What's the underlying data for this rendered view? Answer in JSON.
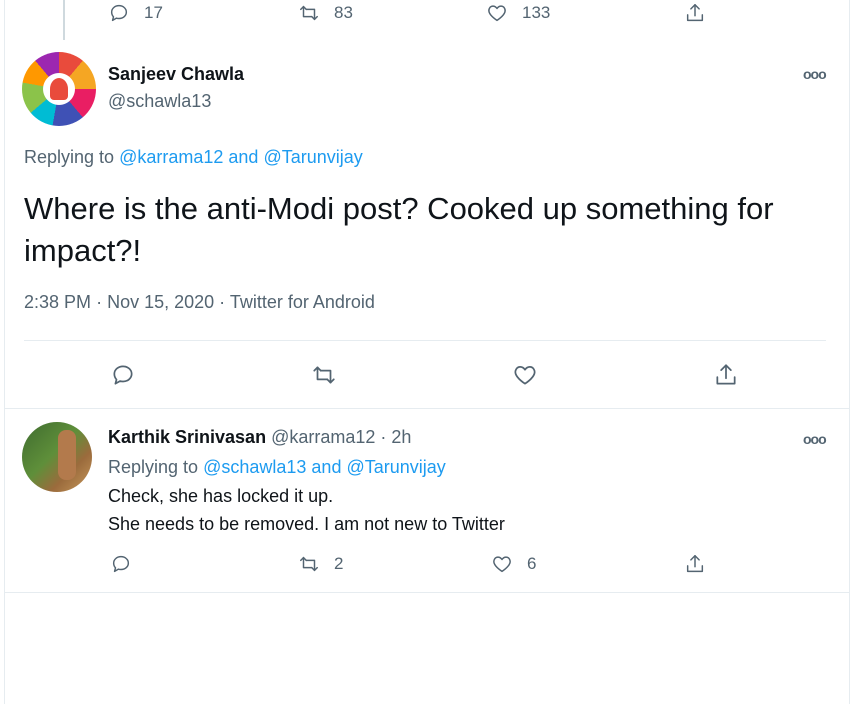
{
  "prev_tweet": {
    "counts": {
      "replies": "17",
      "retweets": "83",
      "likes": "133"
    }
  },
  "main_tweet": {
    "name": "Sanjeev Chawla",
    "handle": "@schawla13",
    "more": "ooo",
    "replying_prefix": "Replying to",
    "reply_to_1": "@karrama12",
    "reply_and": "and",
    "reply_to_2": "@Tarunvijay",
    "text": "Where is the anti-Modi post? Cooked up something for impact?!",
    "time": "2:38 PM",
    "date": "Nov 15, 2020",
    "source": "Twitter for Android",
    "meta_sep": "·"
  },
  "reply_tweet": {
    "name": "Karthik Srinivasan",
    "handle": "@karrama12",
    "age": "2h",
    "meta_sep": "·",
    "more": "ooo",
    "replying_prefix": "Replying to",
    "reply_to_1": "@schawla13",
    "reply_and": "and",
    "reply_to_2": "@Tarunvijay",
    "line1": "Check, she has locked it up.",
    "line2": "She needs to be removed. I am not new to Twitter",
    "counts": {
      "retweets": "2",
      "likes": "6"
    }
  },
  "icons": {
    "reply": "reply-icon",
    "retweet": "retweet-icon",
    "like": "like-icon",
    "share": "share-icon",
    "more": "more-icon"
  },
  "colors": {
    "link": "#1d9bf0",
    "muted": "#536471",
    "text": "#0f1419",
    "divider": "#e6ecf0"
  }
}
